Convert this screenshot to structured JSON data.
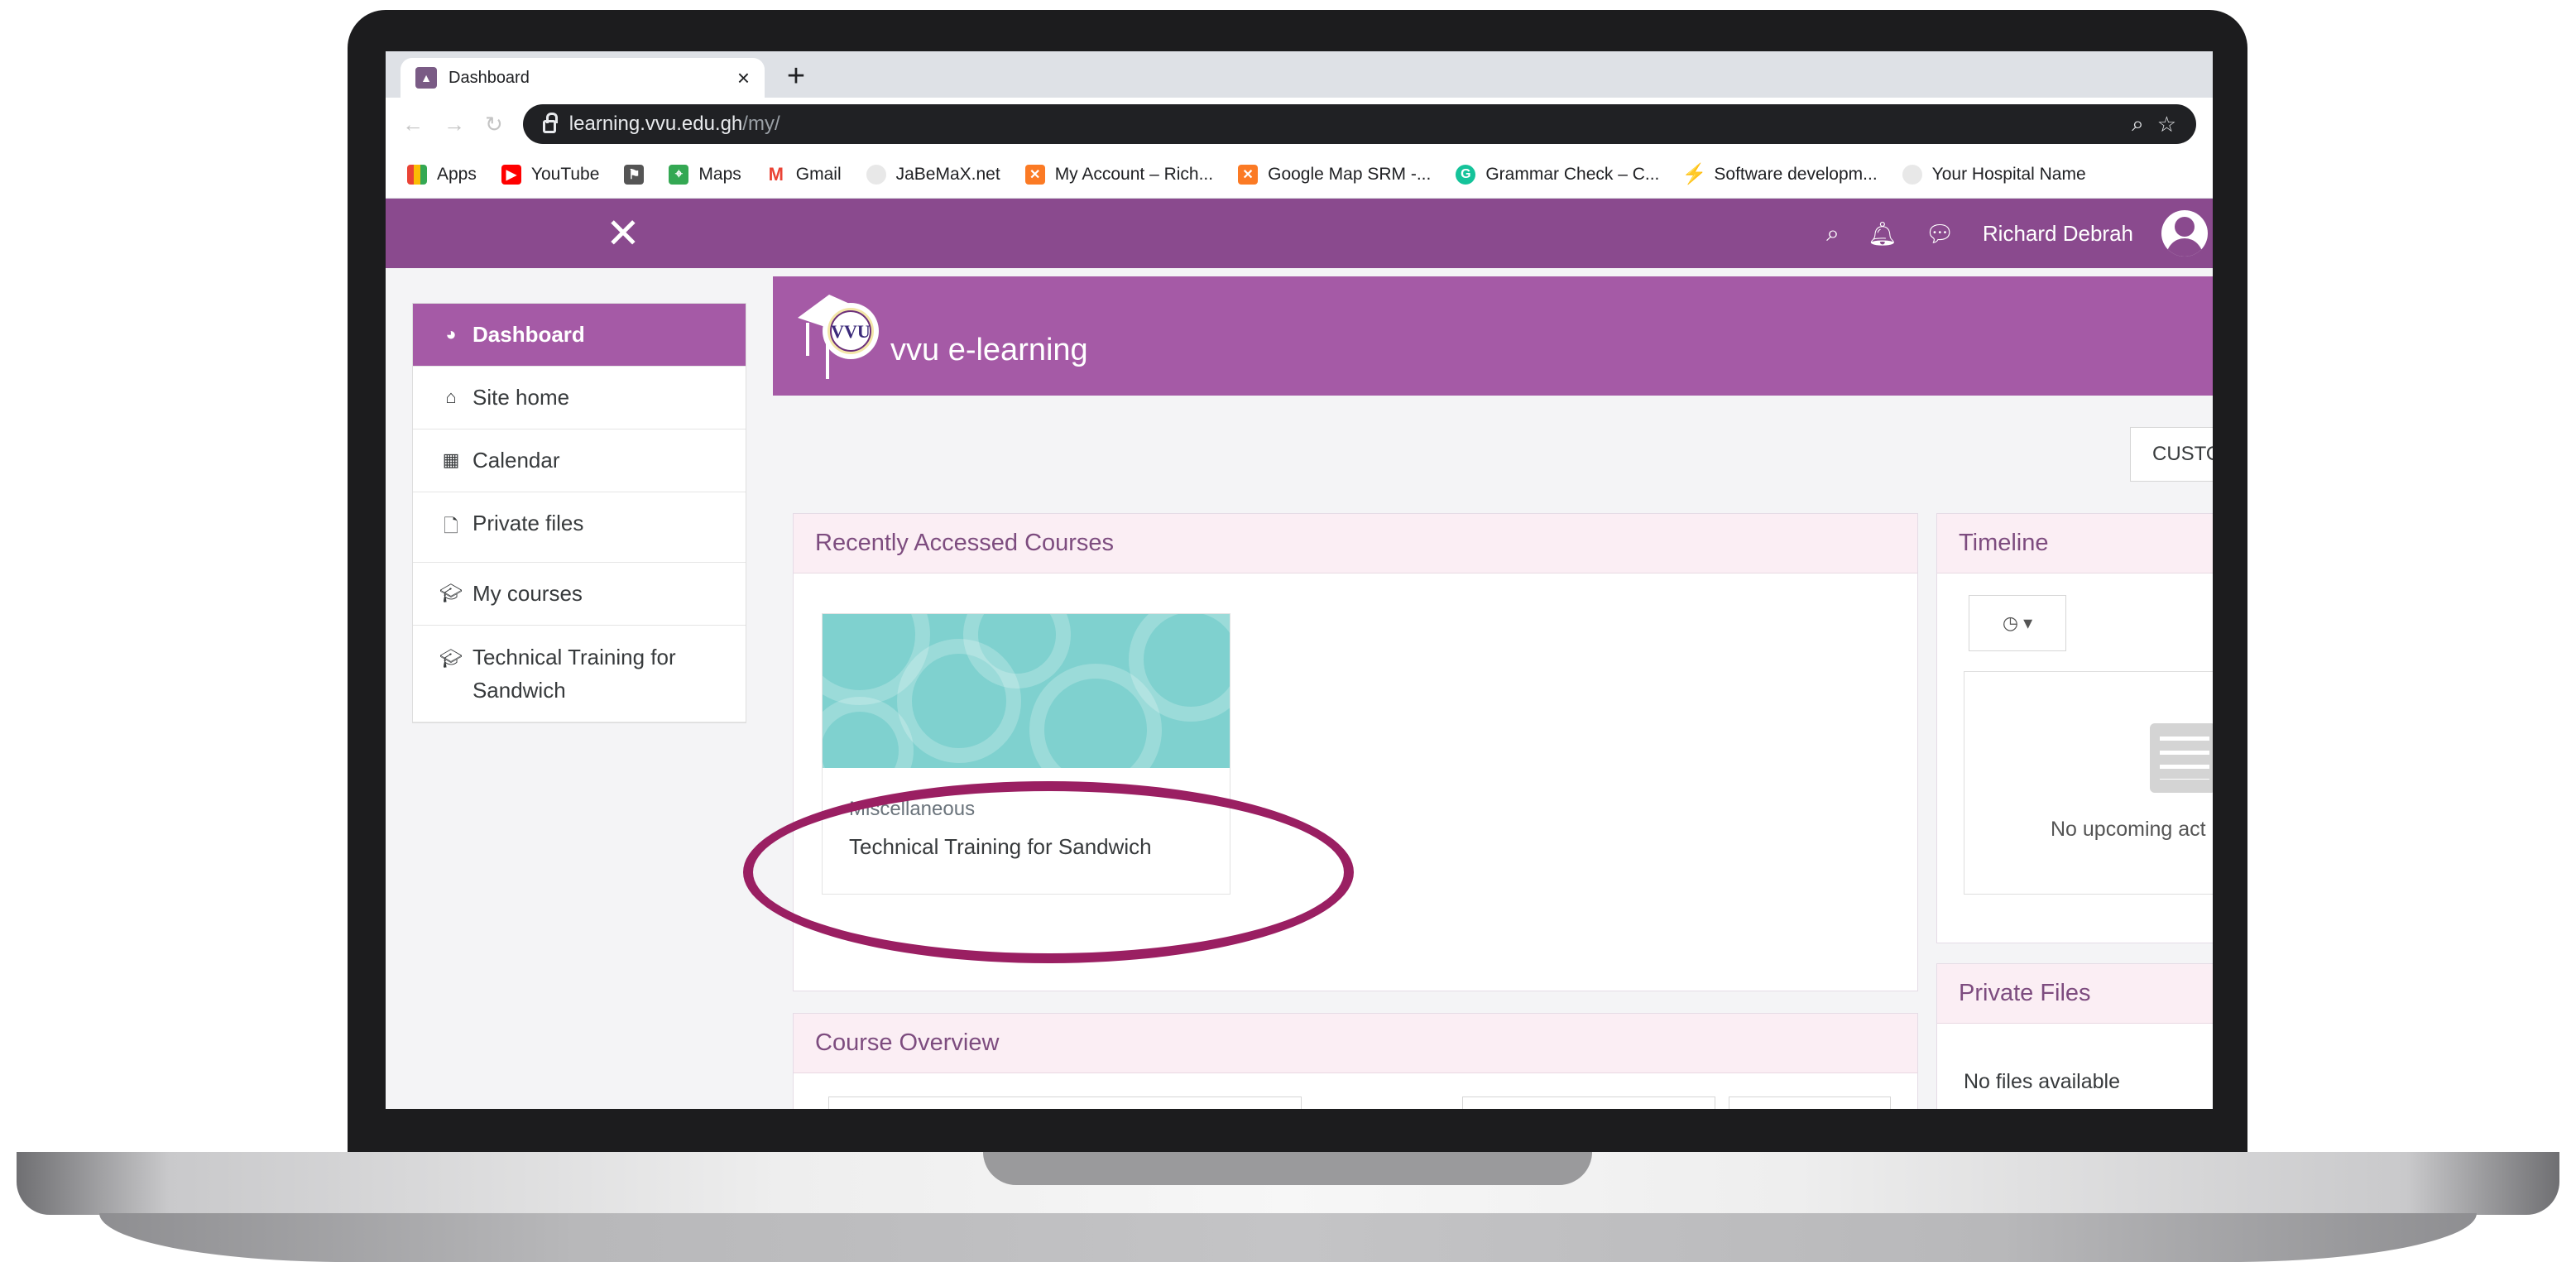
{
  "browser": {
    "tab_title": "Dashboard",
    "tab_close": "×",
    "new_tab": "+",
    "url_host": "learning.vvu.edu.gh",
    "url_path": "/my/",
    "bookmarks": [
      {
        "label": "Apps",
        "icon": "apps-grid-icon"
      },
      {
        "label": "YouTube",
        "icon": "youtube-icon"
      },
      {
        "label": "",
        "icon": "bookmark-extension-icon"
      },
      {
        "label": "Maps",
        "icon": "maps-icon"
      },
      {
        "label": "Gmail",
        "icon": "gmail-icon"
      },
      {
        "label": "JaBeMaX.net",
        "icon": "globe-icon"
      },
      {
        "label": "My Account – Rich...",
        "icon": "xampp-icon"
      },
      {
        "label": "Google Map SRM -...",
        "icon": "xampp-icon"
      },
      {
        "label": "Grammar Check – C...",
        "icon": "grammar-icon"
      },
      {
        "label": "Software developm...",
        "icon": "software-icon"
      },
      {
        "label": "Your Hospital Name",
        "icon": "globe-icon"
      }
    ]
  },
  "nav": {
    "username": "Richard Debrah"
  },
  "drawer": {
    "items": [
      {
        "label": "Dashboard",
        "active": true
      },
      {
        "label": "Site home"
      },
      {
        "label": "Calendar"
      },
      {
        "label": "Private files"
      },
      {
        "label": "My courses"
      },
      {
        "label": "Technical Training for Sandwich"
      }
    ]
  },
  "banner": {
    "logo_text": "VVU",
    "site_name": "vvu e-learning"
  },
  "main": {
    "customise_label": "CUSTO",
    "recent": {
      "title": "Recently Accessed Courses",
      "course": {
        "category": "Miscellaneous",
        "name": "Technical Training for Sandwich"
      }
    },
    "overview": {
      "title": "Course Overview"
    }
  },
  "side": {
    "timeline": {
      "title": "Timeline",
      "empty": "No upcoming act"
    },
    "private_files": {
      "title": "Private Files",
      "empty": "No files available"
    }
  },
  "colors": {
    "brand_purple": "#8a4a8e",
    "banner_purple": "#a55aa6",
    "highlight_ring": "#9a1f62"
  }
}
